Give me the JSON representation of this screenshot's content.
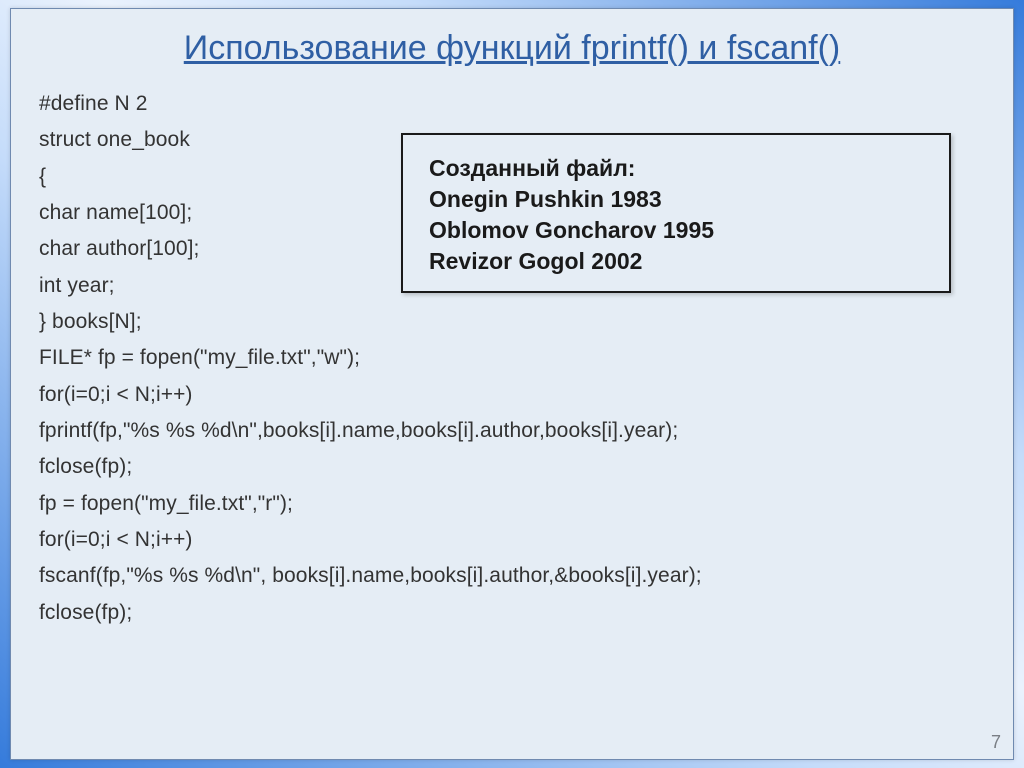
{
  "title": "Использование функций fprintf() и fscanf()",
  "code": {
    "l1": "#define N 2",
    "l2": "struct one_book",
    "l3": "{",
    "l4": "char name[100];",
    "l5": "char author[100];",
    "l6": "int year;",
    "l7": "} books[N];",
    "l8": "FILE* fp = fopen(\"my_file.txt\",\"w\");",
    "l9": "for(i=0;i < N;i++)",
    "l10": "fprintf(fp,\"%s %s %d\\n\",books[i].name,books[i].author,books[i].year);",
    "l11": "fclose(fp);",
    "l12": "fp = fopen(\"my_file.txt\",\"r\");",
    "l13": "for(i=0;i < N;i++)",
    "l14": "fscanf(fp,\"%s %s %d\\n\", books[i].name,books[i].author,&books[i].year);",
    "l15": "fclose(fp);"
  },
  "output": {
    "heading": "Созданный файл:",
    "l1": "Onegin Pushkin 1983",
    "l2": "Oblomov Goncharov 1995",
    "l3": "Revizor Gogol 2002"
  },
  "page": "7"
}
